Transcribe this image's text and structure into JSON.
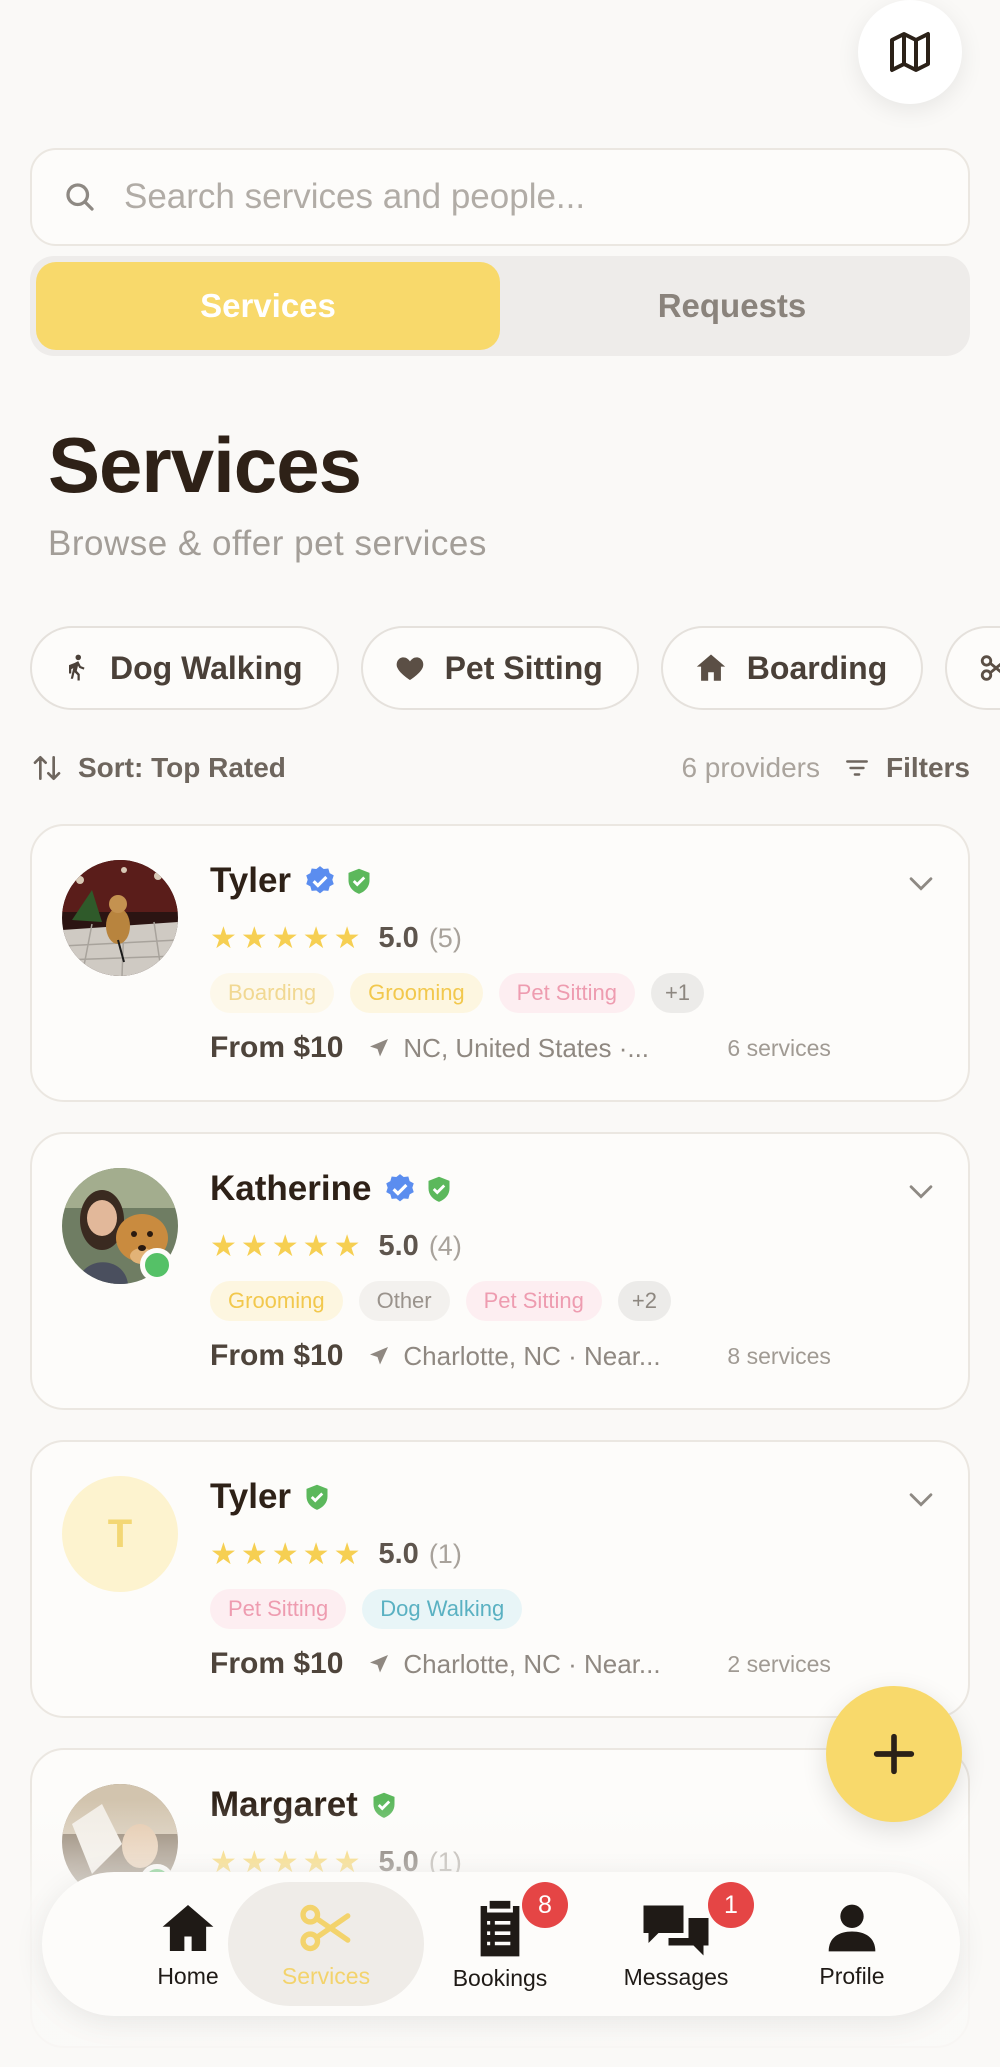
{
  "search": {
    "placeholder": "Search services and people..."
  },
  "tabs": [
    {
      "label": "Services",
      "active": true
    },
    {
      "label": "Requests",
      "active": false
    }
  ],
  "header": {
    "title": "Services",
    "subtitle": "Browse & offer pet services"
  },
  "categories": [
    {
      "label": "Dog Walking",
      "icon": "walking-person-icon"
    },
    {
      "label": "Pet Sitting",
      "icon": "heart-icon"
    },
    {
      "label": "Boarding",
      "icon": "house-icon"
    }
  ],
  "sortbar": {
    "sort_label": "Sort: Top Rated",
    "count": "6 providers",
    "filters_label": "Filters"
  },
  "providers": [
    {
      "name": "Tyler",
      "stars": "★★★★★",
      "score": "5.0",
      "reviews": "(5)",
      "tags": [
        "Boarding",
        "Grooming",
        "Pet Sitting",
        "+1"
      ],
      "price": "From $10",
      "location": "NC, United States ·...",
      "services": "6 services"
    },
    {
      "name": "Katherine",
      "stars": "★★★★★",
      "score": "5.0",
      "reviews": "(4)",
      "tags": [
        "Grooming",
        "Other",
        "Pet Sitting",
        "+2"
      ],
      "price": "From $10",
      "location": "Charlotte, NC · Near...",
      "services": "8 services"
    },
    {
      "name": "Tyler",
      "initial": "T",
      "stars": "★★★★★",
      "score": "5.0",
      "reviews": "(1)",
      "tags": [
        "Pet Sitting",
        "Dog Walking"
      ],
      "price": "From $10",
      "location": "Charlotte, NC · Near...",
      "services": "2 services"
    },
    {
      "name": "Margaret",
      "stars": "★★★★★",
      "score": "5.0",
      "reviews": "(1)"
    }
  ],
  "nav": [
    {
      "label": "Home",
      "icon": "home-icon"
    },
    {
      "label": "Services",
      "icon": "scissors-icon",
      "active": true
    },
    {
      "label": "Bookings",
      "icon": "clipboard-icon",
      "badge": "8"
    },
    {
      "label": "Messages",
      "icon": "chat-bubbles-icon",
      "badge": "1"
    },
    {
      "label": "Profile",
      "icon": "person-icon"
    }
  ],
  "colors": {
    "accent": "#f8d96b",
    "verified_blue": "#5b8def",
    "verified_green": "#5cb85c",
    "badge_red": "#e54545"
  }
}
